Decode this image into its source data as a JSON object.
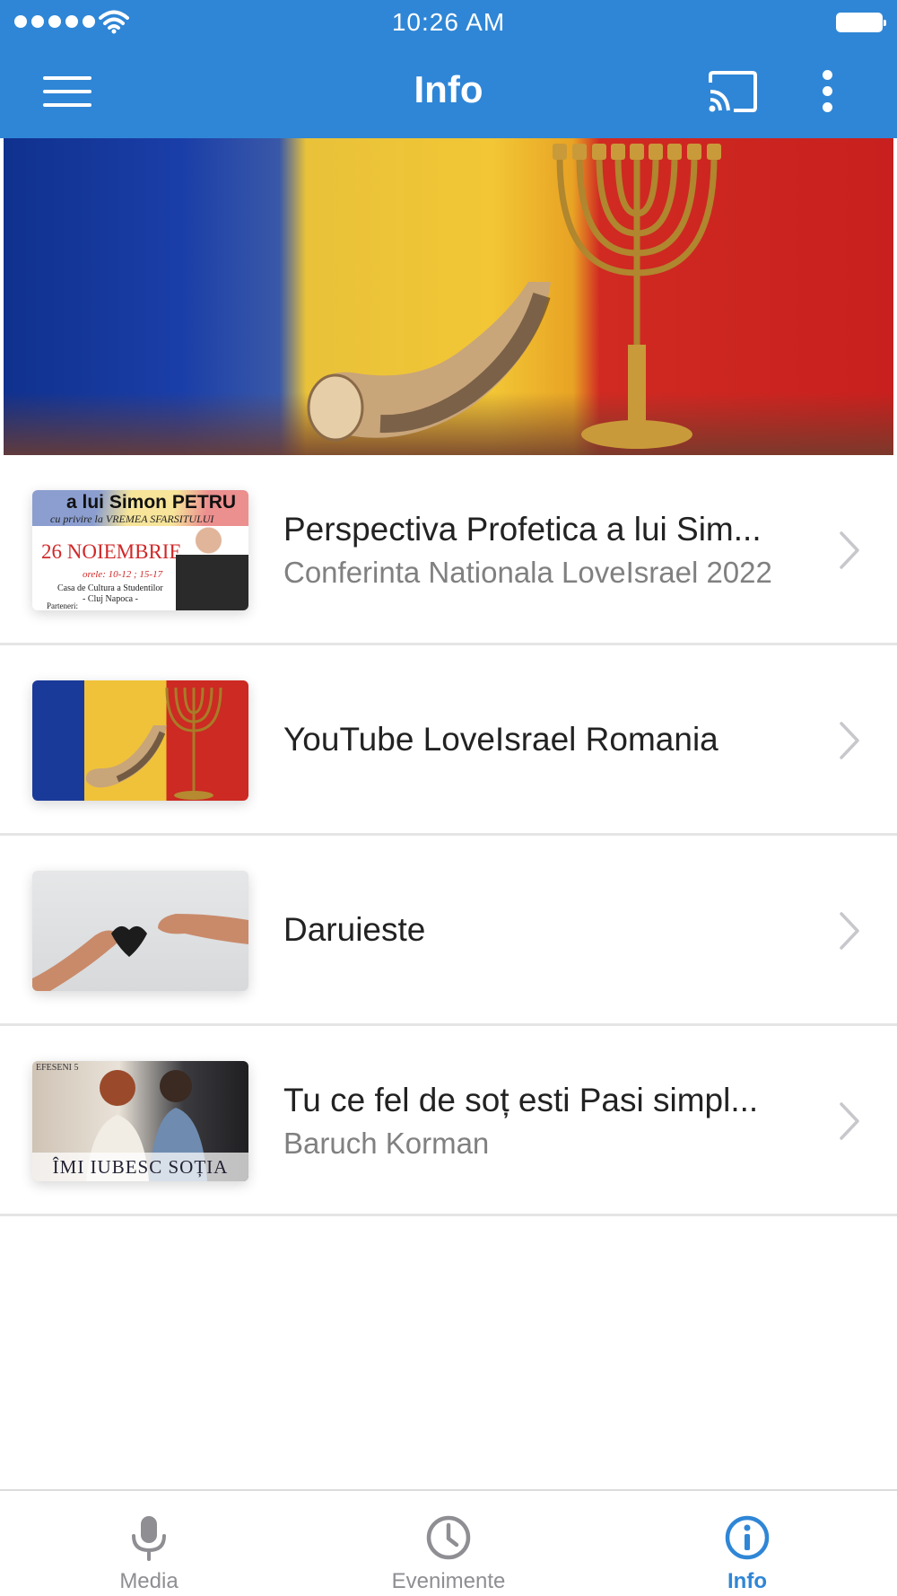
{
  "status_bar": {
    "time": "10:26 AM"
  },
  "header": {
    "title": "Info",
    "cast_icon": "cast-icon",
    "more_icon": "more-vertical-icon",
    "menu_icon": "hamburger-menu-icon"
  },
  "colors": {
    "accent": "#2f86d6",
    "divider": "#e5e5e5",
    "secondary_text": "#808080",
    "inactive_tab": "#8e8e93"
  },
  "items": [
    {
      "title": "Perspectiva Profetica a lui Sim...",
      "subtitle": "Conferinta Nationala LoveIsrael 2022",
      "thumb_text": [
        "a lui Simon PETRU",
        "cu privire la VREMEA SFARSITULUI",
        "26 NOIEMBRIE",
        "orele: 10-12 ; 15-17",
        "Casa de Cultura a Studentilor",
        "- Cluj Napoca -",
        "Parteneri:"
      ]
    },
    {
      "title": "YouTube LoveIsrael Romania",
      "subtitle": ""
    },
    {
      "title": "Daruieste",
      "subtitle": ""
    },
    {
      "title": "Tu ce fel de soț esti   Pasi simpl...",
      "subtitle": "Baruch Korman",
      "thumb_text": [
        "EFESENI 5",
        "ÎMI IUBESC SOȚIA"
      ]
    }
  ],
  "tabs": [
    {
      "label": "Media",
      "icon": "microphone-icon",
      "active": false
    },
    {
      "label": "Evenimente",
      "icon": "clock-icon",
      "active": false
    },
    {
      "label": "Info",
      "icon": "info-icon",
      "active": true
    }
  ]
}
